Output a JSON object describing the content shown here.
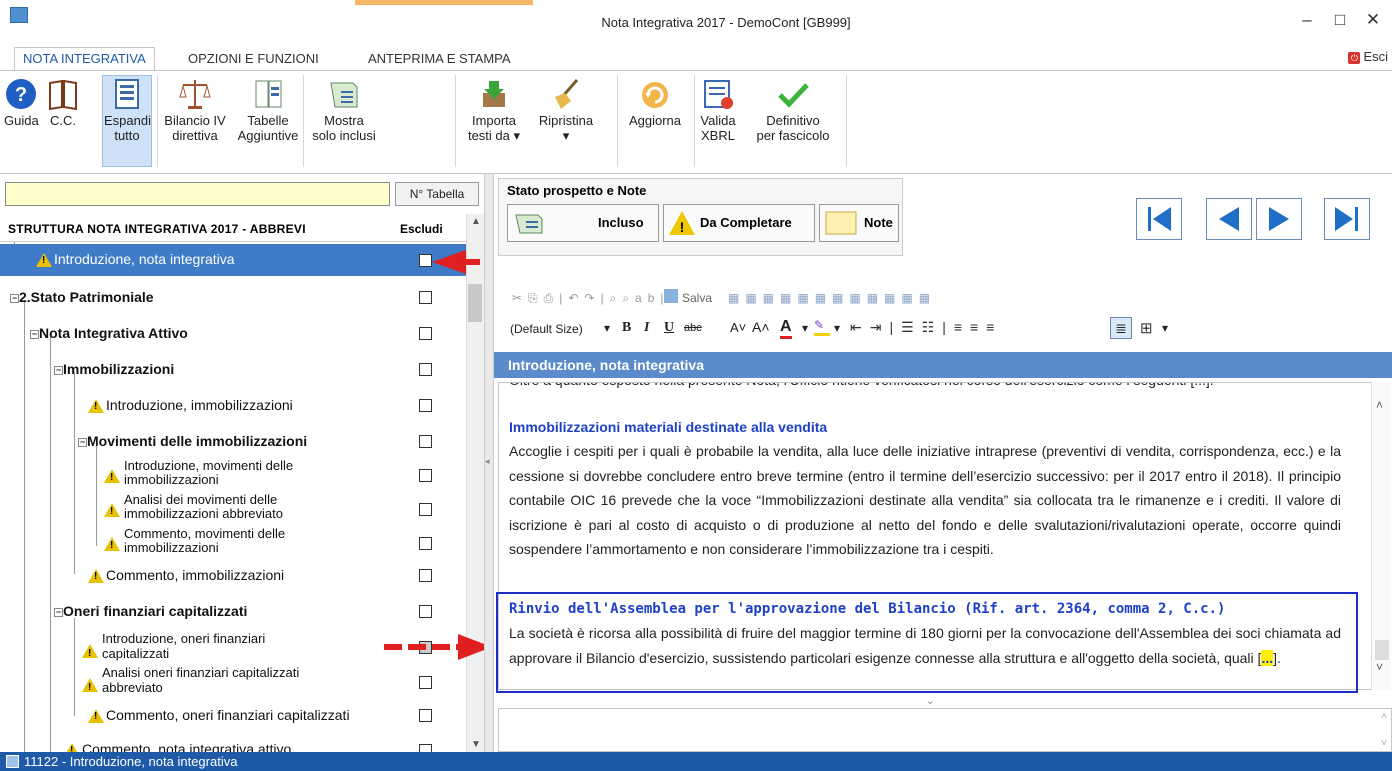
{
  "window": {
    "title": "Nota Integrativa 2017 - DemoCont [GB999]",
    "minimize": "–",
    "maximize": "□",
    "close": "✕"
  },
  "tabs": [
    {
      "label": "NOTA INTEGRATIVA"
    },
    {
      "label": "OPZIONI E FUNZIONI"
    },
    {
      "label": "ANTEPRIMA E STAMPA"
    }
  ],
  "esci": "Esci",
  "ribbon": {
    "guida": "Guida",
    "cc": "C.C.",
    "espandi": [
      "Espandi",
      "tutto"
    ],
    "bilancio": [
      "Bilancio IV",
      "direttiva"
    ],
    "tabelle": [
      "Tabelle",
      "Aggiuntive"
    ],
    "mostra": [
      "Mostra",
      "solo inclusi"
    ],
    "importa": [
      "Importa",
      "testi da ▾"
    ],
    "ripristina": [
      "Ripristina",
      "▾"
    ],
    "aggiorna": "Aggiorna",
    "valida": [
      "Valida",
      "XBRL"
    ],
    "definitivo": [
      "Definitivo",
      "per fascicolo"
    ]
  },
  "left": {
    "search_value": "",
    "ntab_button": "N° Tabella",
    "tree_header": "STRUTTURA NOTA INTEGRATIVA 2017 - ABBREVI",
    "escludi": "Escludi",
    "rows": [
      {
        "label": "Introduzione, nota integrativa"
      },
      {
        "label": "2.Stato Patrimoniale"
      },
      {
        "label": "Nota Integrativa Attivo"
      },
      {
        "label": "Immobilizzazioni"
      },
      {
        "label": "Introduzione, immobilizzazioni"
      },
      {
        "label": "Movimenti delle immobilizzazioni"
      },
      {
        "label1": "Introduzione, movimenti delle",
        "label2": "immobilizzazioni"
      },
      {
        "label1": "Analisi dei movimenti delle",
        "label2": "immobilizzazioni abbreviato"
      },
      {
        "label1": "Commento, movimenti delle",
        "label2": "immobilizzazioni"
      },
      {
        "label": "Commento, immobilizzazioni"
      },
      {
        "label": "Oneri finanziari capitalizzati"
      },
      {
        "label1": "Introduzione, oneri finanziari",
        "label2": "capitalizzati"
      },
      {
        "label1": "Analisi oneri finanziari capitalizzati",
        "label2": "abbreviato"
      },
      {
        "label": "Commento, oneri finanziari capitalizzati"
      },
      {
        "label": "Commento, nota integrativa attivo"
      }
    ]
  },
  "stato": {
    "title": "Stato prospetto e Note",
    "incluso": "Incluso",
    "da_completare": "Da Completare",
    "note": "Note"
  },
  "toolbar": {
    "salva": "Salva",
    "font_size": "(Default Size)"
  },
  "editor": {
    "header": "Introduzione, nota integrativa",
    "cut_line": "Oltre a quanto esposto nella presente Nota, l'Ufficio ritiene verificatosi nel corso dell'esercizio come i seguenti [...].",
    "h1": "Immobilizzazioni materiali destinate alla vendita",
    "p1": "Accoglie i cespiti per i quali è probabile la vendita, alla luce delle iniziative intraprese (preventivi di vendita, corrispondenza, ecc.) e la cessione si dovrebbe concludere entro breve termine (entro il termine dell’esercizio successivo: per il 2017 entro il 2018). Il principio contabile OIC 16 prevede che la voce “Immobilizzazioni destinate alla vendita” sia collocata tra le rimanenze e i crediti. Il valore di iscrizione è pari al costo di acquisto o di produzione al netto del fondo e delle svalutazioni/rivalutazioni operate, occorre quindi sospendere l’ammortamento e non considerare l’immobilizzazione tra i cespiti.",
    "h2": "Rinvio dell'Assemblea per l'approvazione del Bilancio (Rif. art. 2364, comma 2, C.c.)",
    "p2": "La società è ricorsa alla possibilità di fruire del maggior termine di 180 giorni per la convocazione dell'Assemblea dei soci chiamata ad approvare il Bilancio d'esercizio, sussistendo particolari esigenze connesse alla struttura e all'oggetto della società, quali [",
    "p2_hi": "...",
    "p2_end": "]."
  },
  "status": "11122 - Introduzione, nota integrativa",
  "colors": {
    "accent": "#1e5aa8",
    "selection": "#3f7bc6",
    "header": "#5b8bcb",
    "highlight": "#1c2fc8",
    "arrow": "#e02020"
  }
}
